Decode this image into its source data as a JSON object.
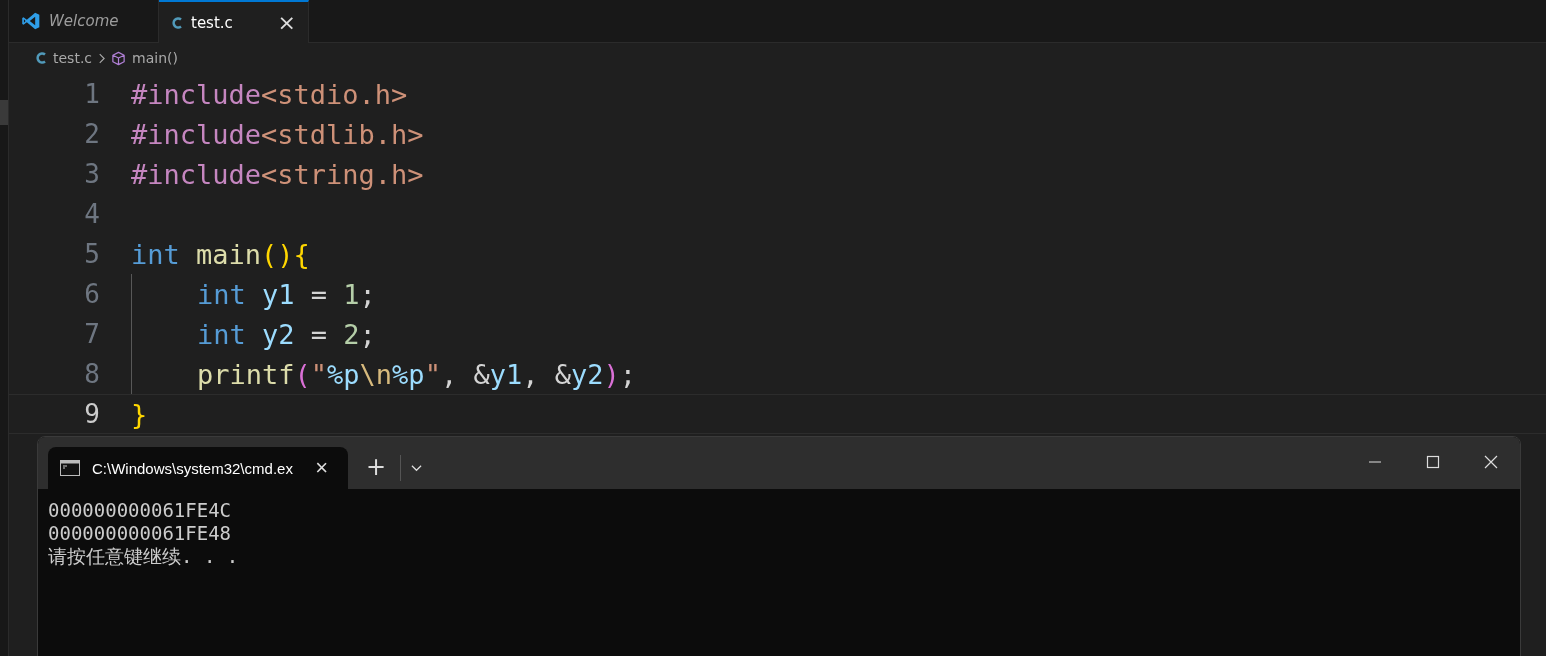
{
  "editor_tabs": [
    {
      "label": "Welcome",
      "kind": "welcome",
      "selected": false
    },
    {
      "label": "test.c",
      "kind": "c",
      "selected": true,
      "close": "×"
    }
  ],
  "breadcrumb": [
    {
      "label": "test.c",
      "kind": "c"
    },
    {
      "label": "main()",
      "kind": "symbol"
    }
  ],
  "code_lines": [
    {
      "number": "1",
      "selected": false,
      "tokens": [
        {
          "text": "#include",
          "kind": "preproc"
        },
        {
          "text": "<stdio.h>",
          "kind": "header"
        }
      ]
    },
    {
      "number": "2",
      "selected": false,
      "tokens": [
        {
          "text": "#include",
          "kind": "preproc"
        },
        {
          "text": "<stdlib.h>",
          "kind": "header"
        }
      ]
    },
    {
      "number": "3",
      "selected": false,
      "tokens": [
        {
          "text": "#include",
          "kind": "preproc"
        },
        {
          "text": "<string.h>",
          "kind": "header"
        }
      ]
    },
    {
      "number": "4",
      "selected": false
    },
    {
      "number": "5",
      "selected": false,
      "tokens": [
        {
          "text": "int ",
          "kind": "keyword"
        },
        {
          "text": "main",
          "kind": "function"
        },
        {
          "text": "()",
          "kind": "bracket1"
        },
        {
          "text": "{",
          "kind": "bracket1"
        }
      ],
      "children": [
        {
          "number": "6",
          "selected": false,
          "tokens": [
            {
              "text": "int ",
              "kind": "keyword"
            },
            {
              "text": "y1",
              "kind": "variable"
            },
            {
              "text": " = ",
              "kind": "punct"
            },
            {
              "text": "1",
              "kind": "number"
            },
            {
              "text": ";",
              "kind": "punct"
            }
          ]
        },
        {
          "number": "7",
          "selected": false,
          "tokens": [
            {
              "text": "int ",
              "kind": "keyword"
            },
            {
              "text": "y2",
              "kind": "variable"
            },
            {
              "text": " = ",
              "kind": "punct"
            },
            {
              "text": "2",
              "kind": "number"
            },
            {
              "text": ";",
              "kind": "punct"
            }
          ]
        },
        {
          "number": "8",
          "selected": false,
          "tokens": [
            {
              "text": "printf",
              "kind": "function"
            },
            {
              "text": "(",
              "kind": "bracket2"
            },
            {
              "text": "\"",
              "kind": "string"
            },
            {
              "text": "%p",
              "kind": "format"
            },
            {
              "text": "\\n",
              "kind": "escape"
            },
            {
              "text": "%p",
              "kind": "format"
            },
            {
              "text": "\"",
              "kind": "string"
            },
            {
              "text": ", &",
              "kind": "punct"
            },
            {
              "text": "y1",
              "kind": "variable"
            },
            {
              "text": ", &",
              "kind": "punct"
            },
            {
              "text": "y2",
              "kind": "variable"
            },
            {
              "text": ")",
              "kind": "bracket2"
            },
            {
              "text": ";",
              "kind": "punct"
            }
          ]
        }
      ]
    },
    {
      "number": "9",
      "selected": true,
      "tokens": [
        {
          "text": "}",
          "kind": "bracket1"
        }
      ]
    }
  ],
  "terminal": {
    "tabs": [
      {
        "label": "C:\\Windows\\system32\\cmd.ex",
        "selected": true,
        "close": "×"
      }
    ],
    "new_tab": "+",
    "output": [
      "000000000061FE4C",
      "000000000061FE48",
      "请按任意键继续. . ."
    ]
  }
}
